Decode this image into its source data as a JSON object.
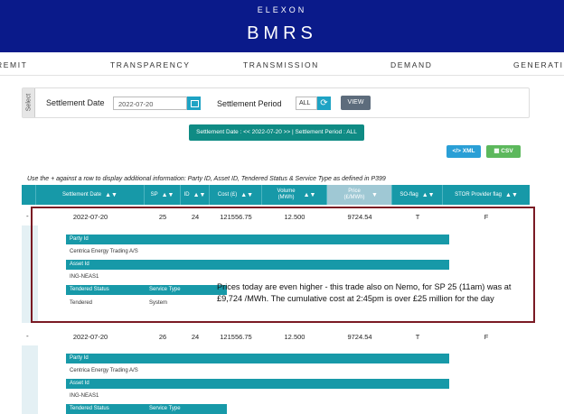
{
  "header": {
    "brand_small": "ELEXON",
    "brand_big": "BMRS"
  },
  "nav": {
    "items": [
      "REMIT",
      "TRANSPARENCY",
      "TRANSMISSION",
      "DEMAND",
      "GENERATION"
    ]
  },
  "filters": {
    "tab_label": "Select",
    "date_label": "Settlement Date",
    "date_value": "2022-07-20",
    "period_label": "Settlement Period",
    "period_value": "ALL",
    "view_label": "VIEW"
  },
  "info_badge": "Settlement Date : << 2022-07-20 >> | Settlement Period : ALL",
  "exports": {
    "xml_label": "XML",
    "csv_label": "CSV"
  },
  "instructions": "Use the + against a row to display additional information: Party ID, Asset ID, Tendered Status & Service Type as defined in P399",
  "table": {
    "headers": [
      "Settlement Date",
      "SP",
      "ID",
      "Cost (£)",
      "Volume (MWh)",
      "Price (£/MWh)",
      "SO-flag",
      "STOR Provider flag"
    ],
    "rows": [
      {
        "toggle": "-",
        "date": "2022-07-20",
        "sp": "25",
        "id": "24",
        "cost": "121556.75",
        "volume": "12.500",
        "price": "9724.54",
        "so_flag": "T",
        "stor_flag": "F"
      },
      {
        "toggle": "-",
        "date": "2022-07-20",
        "sp": "26",
        "id": "24",
        "cost": "121556.75",
        "volume": "12.500",
        "price": "9724.54",
        "so_flag": "T",
        "stor_flag": "F"
      }
    ],
    "details": [
      {
        "party_label": "Party Id",
        "party_value": "Centrica Energy Trading A/S",
        "asset_label": "Asset Id",
        "asset_value": "ING-NEAS1",
        "tendered_label": "Tendered Status",
        "tendered_value": "Tendered",
        "service_label": "Service Type",
        "service_value": "System"
      },
      {
        "party_label": "Party Id",
        "party_value": "Centrica Energy Trading A/S",
        "asset_label": "Asset Id",
        "asset_value": "ING-NEAS1",
        "tendered_label": "Tendered Status",
        "service_label": "Service Type"
      }
    ]
  },
  "annotation": "Prices today are even higher - this trade also on Nemo, for SP 25 (11am) was at £9,724 /MWh. The cumulative cost at 2:45pm is over £25 million for the day",
  "colors": {
    "header_bg": "#0a1a8a",
    "teal": "#1799a8",
    "annotation_border": "#7a1a24"
  }
}
